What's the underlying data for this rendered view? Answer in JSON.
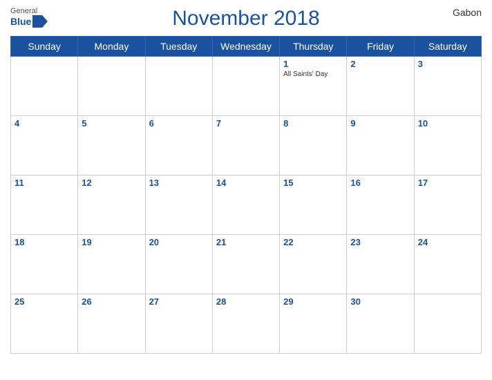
{
  "header": {
    "title": "November 2018",
    "country": "Gabon",
    "logo_general": "General",
    "logo_blue": "Blue"
  },
  "weekdays": [
    "Sunday",
    "Monday",
    "Tuesday",
    "Wednesday",
    "Thursday",
    "Friday",
    "Saturday"
  ],
  "weeks": [
    [
      {
        "day": "",
        "holiday": ""
      },
      {
        "day": "",
        "holiday": ""
      },
      {
        "day": "",
        "holiday": ""
      },
      {
        "day": "",
        "holiday": ""
      },
      {
        "day": "1",
        "holiday": "All Saints' Day"
      },
      {
        "day": "2",
        "holiday": ""
      },
      {
        "day": "3",
        "holiday": ""
      }
    ],
    [
      {
        "day": "4",
        "holiday": ""
      },
      {
        "day": "5",
        "holiday": ""
      },
      {
        "day": "6",
        "holiday": ""
      },
      {
        "day": "7",
        "holiday": ""
      },
      {
        "day": "8",
        "holiday": ""
      },
      {
        "day": "9",
        "holiday": ""
      },
      {
        "day": "10",
        "holiday": ""
      }
    ],
    [
      {
        "day": "11",
        "holiday": ""
      },
      {
        "day": "12",
        "holiday": ""
      },
      {
        "day": "13",
        "holiday": ""
      },
      {
        "day": "14",
        "holiday": ""
      },
      {
        "day": "15",
        "holiday": ""
      },
      {
        "day": "16",
        "holiday": ""
      },
      {
        "day": "17",
        "holiday": ""
      }
    ],
    [
      {
        "day": "18",
        "holiday": ""
      },
      {
        "day": "19",
        "holiday": ""
      },
      {
        "day": "20",
        "holiday": ""
      },
      {
        "day": "21",
        "holiday": ""
      },
      {
        "day": "22",
        "holiday": ""
      },
      {
        "day": "23",
        "holiday": ""
      },
      {
        "day": "24",
        "holiday": ""
      }
    ],
    [
      {
        "day": "25",
        "holiday": ""
      },
      {
        "day": "26",
        "holiday": ""
      },
      {
        "day": "27",
        "holiday": ""
      },
      {
        "day": "28",
        "holiday": ""
      },
      {
        "day": "29",
        "holiday": ""
      },
      {
        "day": "30",
        "holiday": ""
      },
      {
        "day": "",
        "holiday": ""
      }
    ]
  ]
}
